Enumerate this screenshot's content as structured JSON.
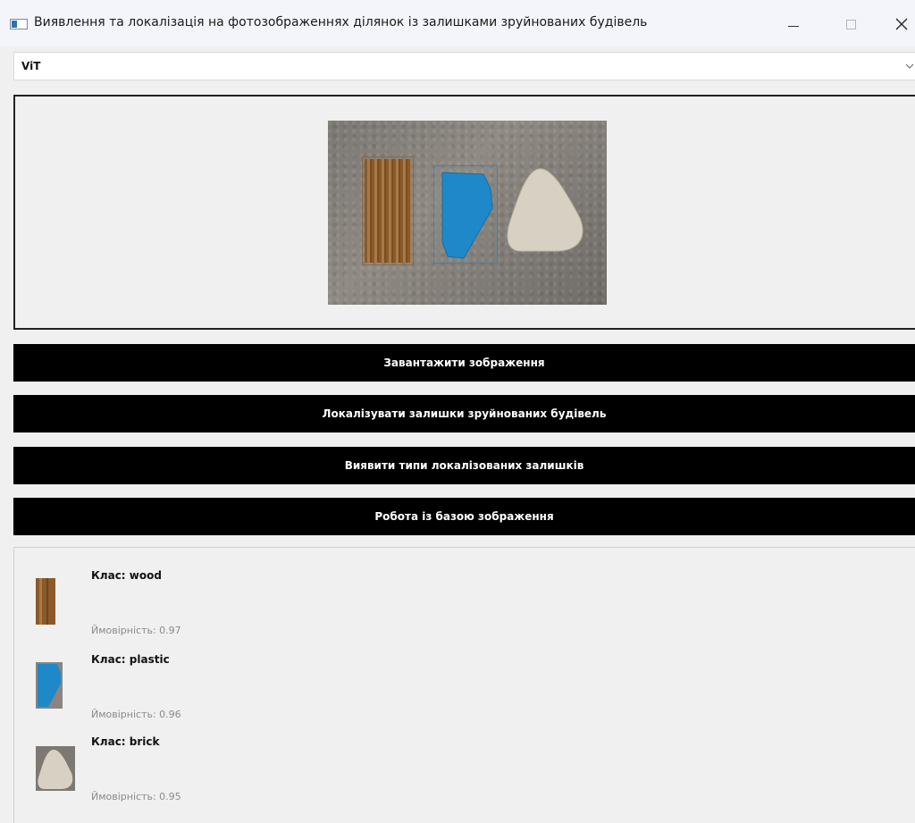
{
  "window": {
    "title": "Виявлення та локалізація на фотозображеннях ділянок із залишками зруйнованих будівель",
    "icons": [
      "app-icon",
      "minimize-icon",
      "maximize-icon",
      "close-icon"
    ]
  },
  "model_select": {
    "value": "ViT",
    "icon": "chevron-down-icon"
  },
  "buttons": {
    "load": "Завантажити зображення",
    "localize": "Локалізувати залишки зруйнованих будівель",
    "detect": "Виявити типи локалізованих залишків",
    "database": "Робота із базою зображення"
  },
  "results": [
    {
      "class_label": "Клас: wood",
      "prob_label": "Ймовірність: 0.97",
      "probability": 0.97,
      "color": "#8a5a2a"
    },
    {
      "class_label": "Клас: plastic",
      "prob_label": "Ймовірність: 0.96",
      "probability": 0.96,
      "color": "#1e88c8"
    },
    {
      "class_label": "Клас: brick",
      "prob_label": "Ймовірність: 0.95",
      "probability": 0.95,
      "color": "#d6d0c4"
    }
  ],
  "colors": {
    "button_bg": "#000000",
    "button_text": "#ffffff",
    "bbox_wood": "#8a6b4a",
    "bbox_plastic": "#2d88c4"
  }
}
